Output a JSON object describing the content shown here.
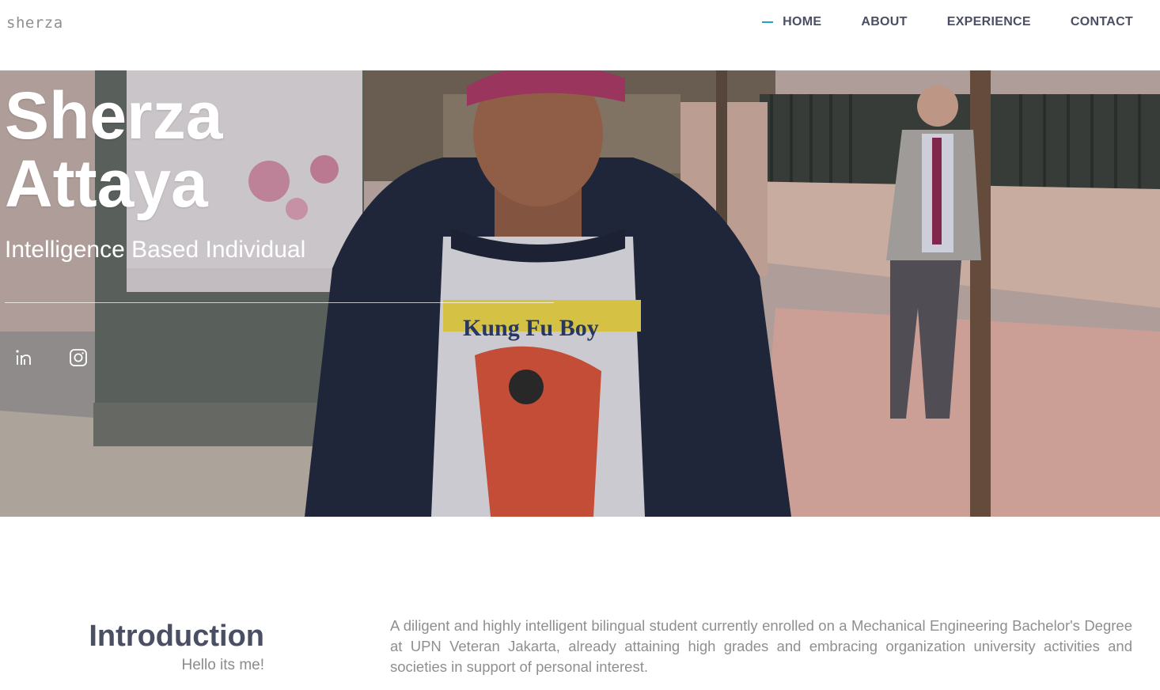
{
  "header": {
    "logo": "sherza",
    "nav": [
      {
        "label": "HOME",
        "active": true
      },
      {
        "label": "ABOUT",
        "active": false
      },
      {
        "label": "EXPERIENCE",
        "active": false
      },
      {
        "label": "CONTACT",
        "active": false
      }
    ],
    "accent_color": "#1ea5c9"
  },
  "hero": {
    "name_line1": "Sherza",
    "name_line2": "Attaya",
    "tagline": "Intelligence Based Individual",
    "background_image": "photo of a young man in a navy jacket and printed t-shirt walking on a sidewalk",
    "shirt_text": "Kung Fu Boy",
    "social": [
      {
        "name": "linkedin",
        "icon": "linkedin-icon"
      },
      {
        "name": "instagram",
        "icon": "instagram-icon"
      }
    ]
  },
  "intro": {
    "title": "Introduction",
    "subtitle": "Hello its me!",
    "body": "A diligent and highly intelligent bilingual student currently enrolled on a Mechanical Engineering Bachelor's Degree at UPN Veteran Jakarta, already attaining high grades and embracing organization university activities and societies in support of personal interest."
  }
}
